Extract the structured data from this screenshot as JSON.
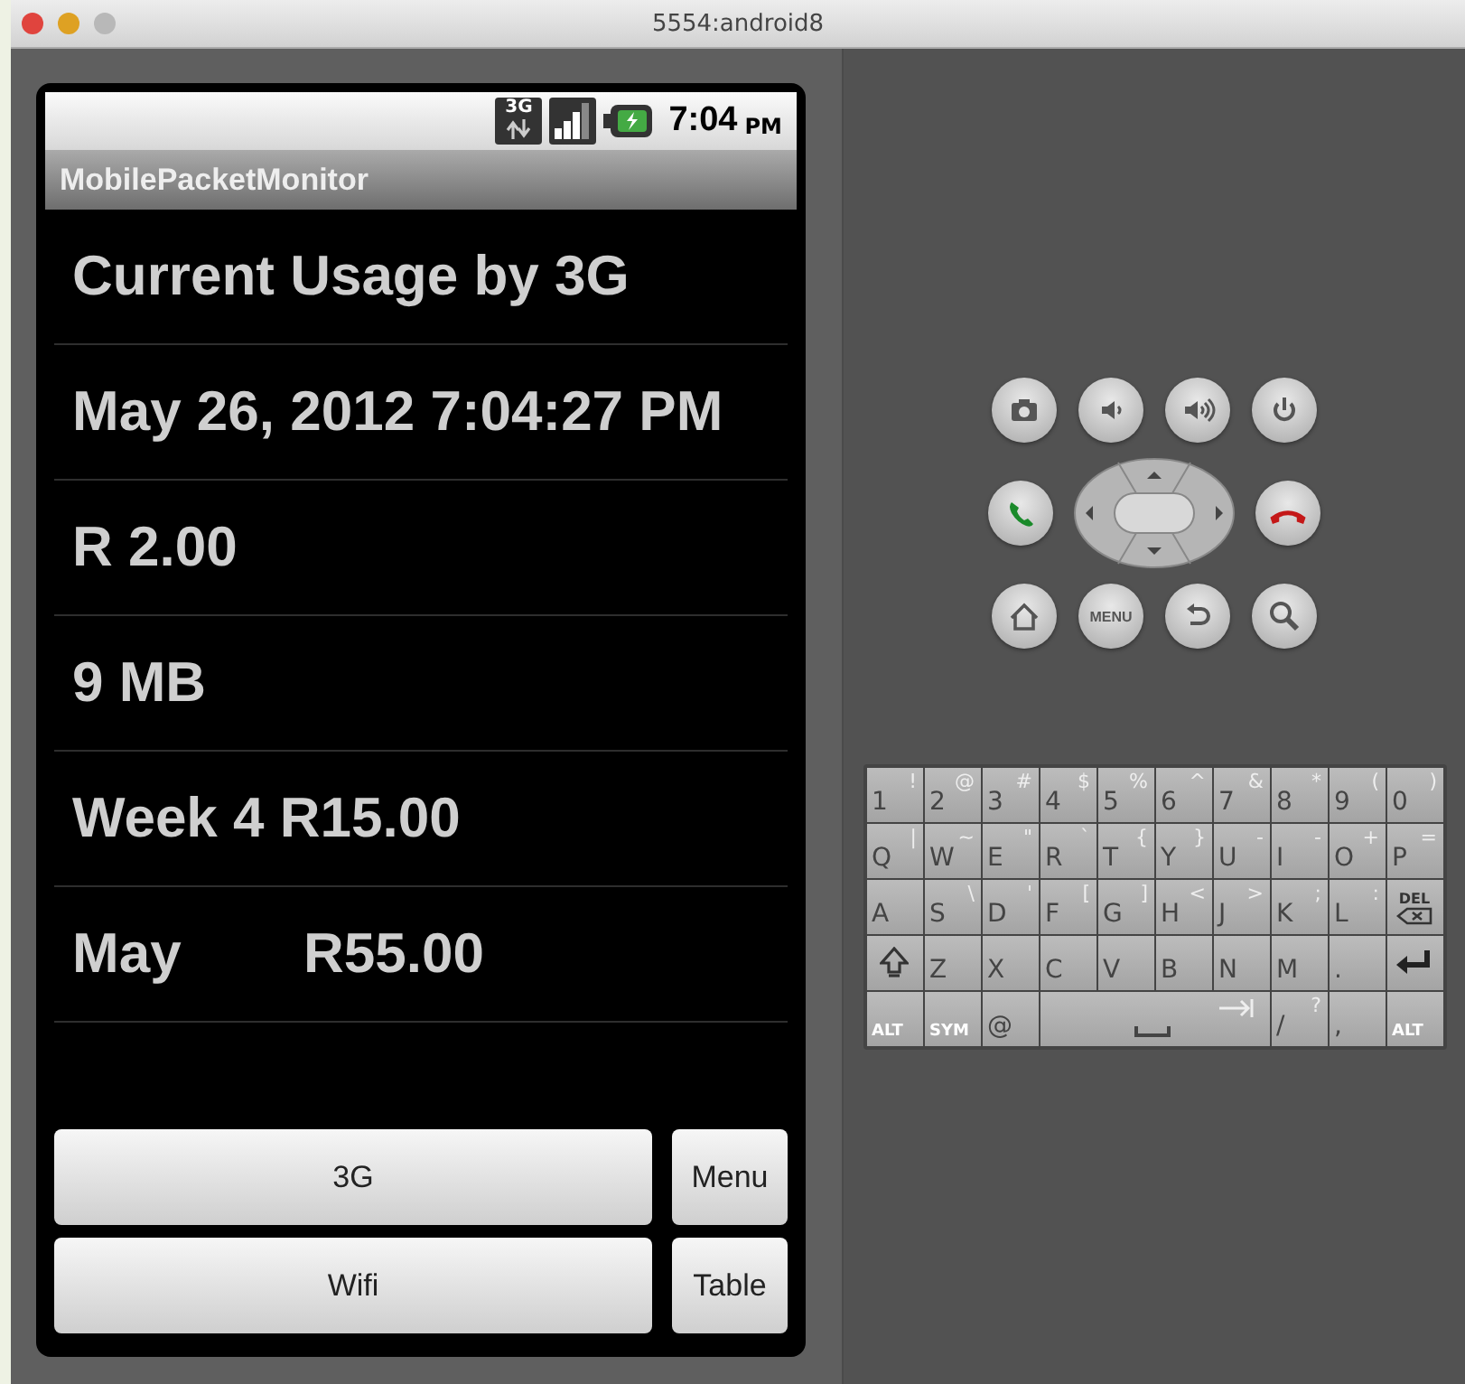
{
  "window": {
    "title": "5554:android8"
  },
  "status_bar": {
    "network": "3G",
    "time": "7:04",
    "ampm": "PM"
  },
  "app_title": "MobilePacketMonitor",
  "rows": [
    {
      "cells": [
        "Current Usage by 3G"
      ]
    },
    {
      "cells": [
        "May 26, 2012 7:04:27 PM"
      ]
    },
    {
      "cells": [
        "R 2.00"
      ]
    },
    {
      "cells": [
        "9 MB"
      ]
    },
    {
      "cells": [
        "Week 4 R15.00"
      ]
    },
    {
      "cells": [
        "May",
        "R55.00"
      ]
    }
  ],
  "buttons": [
    [
      "3G",
      "Menu"
    ],
    [
      "Wifi",
      "Table"
    ]
  ],
  "emulator_keys": [
    [
      {
        "kind": "camera"
      },
      {
        "kind": "volume-down"
      },
      {
        "kind": "volume-up"
      },
      {
        "kind": "power"
      }
    ],
    [
      {
        "kind": "call"
      },
      {
        "kind": "dpad"
      },
      {
        "kind": "end-call"
      }
    ],
    [
      {
        "kind": "home"
      },
      {
        "kind": "menu",
        "label": "MENU"
      },
      {
        "kind": "back"
      },
      {
        "kind": "search"
      }
    ]
  ],
  "keyboard": [
    [
      {
        "main": "1",
        "alt": "!"
      },
      {
        "main": "2",
        "alt": "@"
      },
      {
        "main": "3",
        "alt": "#"
      },
      {
        "main": "4",
        "alt": "$"
      },
      {
        "main": "5",
        "alt": "%"
      },
      {
        "main": "6",
        "alt": "^"
      },
      {
        "main": "7",
        "alt": "&"
      },
      {
        "main": "8",
        "alt": "*"
      },
      {
        "main": "9",
        "alt": "("
      },
      {
        "main": "0",
        "alt": ")"
      }
    ],
    [
      {
        "main": "Q",
        "alt": "|"
      },
      {
        "main": "W",
        "alt": "~"
      },
      {
        "main": "E",
        "alt": "\""
      },
      {
        "main": "R",
        "alt": "`"
      },
      {
        "main": "T",
        "alt": "{"
      },
      {
        "main": "Y",
        "alt": "}"
      },
      {
        "main": "U",
        "alt": "-"
      },
      {
        "main": "I",
        "alt": "-"
      },
      {
        "main": "O",
        "alt": "+"
      },
      {
        "main": "P",
        "alt": "="
      }
    ],
    [
      {
        "main": "A"
      },
      {
        "main": "S",
        "alt": "\\"
      },
      {
        "main": "D",
        "alt": "'"
      },
      {
        "main": "F",
        "alt": "["
      },
      {
        "main": "G",
        "alt": "]"
      },
      {
        "main": "H",
        "alt": "<"
      },
      {
        "main": "J",
        "alt": ">"
      },
      {
        "main": "K",
        "alt": ";"
      },
      {
        "main": "L",
        "alt": ":"
      },
      {
        "kind": "del",
        "main": "DEL"
      }
    ],
    [
      {
        "kind": "shift"
      },
      {
        "main": "Z"
      },
      {
        "main": "X"
      },
      {
        "main": "C"
      },
      {
        "main": "V"
      },
      {
        "main": "B"
      },
      {
        "main": "N"
      },
      {
        "main": "M"
      },
      {
        "main": "."
      },
      {
        "kind": "enter"
      }
    ],
    [
      {
        "kind": "small",
        "main": "ALT"
      },
      {
        "kind": "small",
        "main": "SYM"
      },
      {
        "main": "@"
      },
      {
        "kind": "space"
      },
      {
        "main": "/",
        "alt": "?"
      },
      {
        "main": ","
      },
      {
        "kind": "small",
        "main": "ALT"
      }
    ]
  ]
}
